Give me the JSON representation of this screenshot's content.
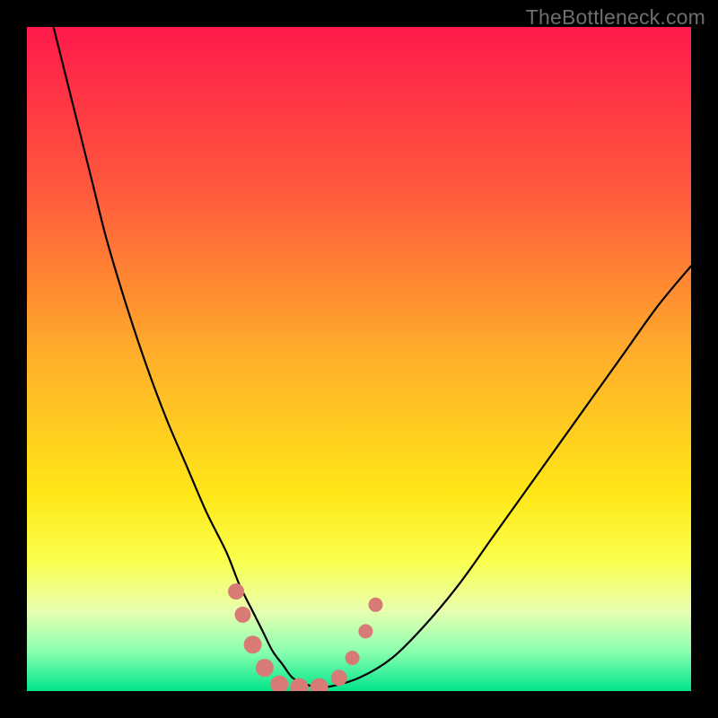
{
  "watermark": "TheBottleneck.com",
  "chart_data": {
    "type": "line",
    "title": "",
    "xlabel": "",
    "ylabel": "",
    "xlim": [
      0,
      100
    ],
    "ylim": [
      0,
      100
    ],
    "gradient_stops": [
      {
        "offset": 0,
        "color": "#ff1a4b"
      },
      {
        "offset": 0.25,
        "color": "#ff5a3c"
      },
      {
        "offset": 0.5,
        "color": "#ffb02a"
      },
      {
        "offset": 0.7,
        "color": "#ffe617"
      },
      {
        "offset": 0.8,
        "color": "#fbff4a"
      },
      {
        "offset": 0.88,
        "color": "#e8ffb0"
      },
      {
        "offset": 0.94,
        "color": "#8bffb0"
      },
      {
        "offset": 1.0,
        "color": "#00e58a"
      }
    ],
    "series": [
      {
        "name": "bottleneck-curve",
        "x": [
          4,
          6,
          8,
          10,
          12,
          15,
          18,
          21,
          24,
          27,
          30,
          32,
          34,
          35.5,
          37,
          38.5,
          40,
          42,
          45,
          50,
          55,
          60,
          65,
          70,
          75,
          80,
          85,
          90,
          95,
          100
        ],
        "y": [
          100,
          92,
          84,
          76,
          68,
          58,
          49,
          41,
          34,
          27,
          21,
          16,
          12,
          9,
          6,
          4,
          2,
          1,
          0.6,
          2,
          5,
          10,
          16,
          23,
          30,
          37,
          44,
          51,
          58,
          64
        ]
      }
    ],
    "markers": {
      "name": "highlight-dots",
      "color": "#d87a75",
      "points": [
        {
          "x": 31.5,
          "y": 15,
          "r": 9
        },
        {
          "x": 32.5,
          "y": 11.5,
          "r": 9
        },
        {
          "x": 34,
          "y": 7,
          "r": 10
        },
        {
          "x": 35.8,
          "y": 3.5,
          "r": 10
        },
        {
          "x": 38,
          "y": 1,
          "r": 10
        },
        {
          "x": 41,
          "y": 0.6,
          "r": 10
        },
        {
          "x": 44,
          "y": 0.6,
          "r": 10
        },
        {
          "x": 47,
          "y": 2,
          "r": 9
        },
        {
          "x": 49,
          "y": 5,
          "r": 8
        },
        {
          "x": 51,
          "y": 9,
          "r": 8
        },
        {
          "x": 52.5,
          "y": 13,
          "r": 8
        }
      ]
    }
  }
}
